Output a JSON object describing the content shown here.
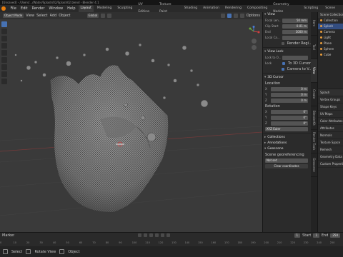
{
  "title_bar": {
    "text": "[Unsaved] - /Users/.../Water/Splash/02/Splash02.blend - Blender 4.1"
  },
  "menus": [
    "File",
    "Edit",
    "Render",
    "Window",
    "Help"
  ],
  "workspaces": [
    "Layout",
    "Modeling",
    "Sculpting",
    "UV Editing",
    "Texture Paint",
    "Shading",
    "Animation",
    "Rendering",
    "Compositing",
    "Geometry Nodes",
    "Scripting"
  ],
  "active_workspace": "Layout",
  "scene_name": "Scene",
  "viewport_header": {
    "mode": "Object Mode",
    "menus": [
      "View",
      "Select",
      "Add",
      "Object"
    ],
    "orientation": "Global",
    "options_label": "Options"
  },
  "npanel": {
    "view_section": "View",
    "focal_length_label": "Focal Len...",
    "focal_length_value": "50 mm",
    "clip_start_label": "Clip Start",
    "clip_start_value": "0.01 m",
    "clip_end_label": "End",
    "clip_end_value": "1000 m",
    "local_camera_label": "Local Ca...",
    "render_region_label": "Render Regi...",
    "view_lock_section": "View Lock",
    "lock_to_object_label": "Lock to O...",
    "lock_label": "Lock",
    "to_3d_cursor_label": "To 3D Cursor",
    "camera_to_view_label": "Camera to V...",
    "cursor_section": "3D Cursor",
    "location_label": "Location",
    "loc_x_label": "X",
    "loc_x_value": "0 m",
    "loc_y_label": "Y",
    "loc_y_value": "0 m",
    "loc_z_label": "Z",
    "loc_z_value": "0 m",
    "rotation_label": "Rotation",
    "rot_x_label": "X",
    "rot_x_value": "0°",
    "rot_y_label": "Y",
    "rot_y_value": "0°",
    "rot_z_label": "Z",
    "rot_z_value": "0°",
    "rotation_mode": "XYZ Euler",
    "collections_section": "Collections",
    "annotations_section": "Annotations",
    "geoscene_section": "Geoscene",
    "georef_label": "Scene georeferencing",
    "crs_label": "Not set",
    "georef_button": "Clear coordinates"
  },
  "npanel_tabs": [
    "Item",
    "Tool",
    "View",
    "Create",
    "BlenderKit",
    "Render Tools",
    "Geoscene"
  ],
  "active_npanel_tab": "View",
  "outliner": {
    "header": "Scene Collection",
    "items": [
      "Scene Collection",
      "Collection",
      "Splash",
      "Camera",
      "Light",
      "Plane",
      "Sphere",
      "Cube"
    ]
  },
  "properties": {
    "object_name": "Splash",
    "items": [
      "Vertex Groups",
      "Shape Keys",
      "UV Maps",
      "Color Attributes",
      "Attributes",
      "Normals",
      "Texture Space",
      "Remesh",
      "Geometry Data",
      "Custom Properties"
    ]
  },
  "timeline": {
    "menu": "Marker",
    "current_frame": "1",
    "start_label": "Start",
    "start_value": "1",
    "end_label": "End",
    "end_value": "250",
    "ruler_ticks": [
      "0",
      "10",
      "20",
      "30",
      "40",
      "50",
      "60",
      "70",
      "80",
      "90",
      "100",
      "110",
      "120",
      "130",
      "140",
      "150",
      "160",
      "170",
      "180",
      "190",
      "200",
      "210",
      "220",
      "230",
      "240",
      "250"
    ]
  },
  "status_bar": {
    "select": "Select",
    "rotate_view": "Rotate View",
    "object": "Object"
  },
  "colors": {
    "accent": "#4772b3",
    "background": "#3a3a3a",
    "panel": "#2b2b2b"
  }
}
